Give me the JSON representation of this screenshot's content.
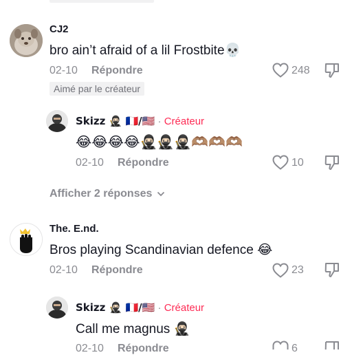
{
  "comments": [
    {
      "username": "CJ2",
      "text": "bro ain’t afraid of a lil Frostbite💀",
      "date": "02-10",
      "reply_label": "Répondre",
      "likes": "248",
      "badge": "Aimé par le créateur",
      "reply": {
        "username": "Skizz 🥷🏻 🇫🇷/🇺🇸",
        "separator": "·",
        "creator_label": "Créateur",
        "text": "😂😂😂😂🥷🏻🥷🏻🥷🏻🫶🏽🫶🏽🫶🏽",
        "date": "02-10",
        "reply_label": "Répondre",
        "likes": "10"
      },
      "view_replies": "Afficher 2 réponses"
    },
    {
      "username": "The. E.nd.",
      "text": "Bros playing Scandinavian defence 😂",
      "date": "02-10",
      "reply_label": "Répondre",
      "likes": "23",
      "reply": {
        "username": "Skizz 🥷🏻 🇫🇷/🇺🇸",
        "separator": "·",
        "creator_label": "Créateur",
        "text": "Call me magnus 🥷🏻",
        "date": "02-10",
        "reply_label": "Répondre",
        "likes": "6"
      }
    }
  ],
  "icons": {
    "heart": "heart-icon",
    "dislike": "thumbs-down-icon",
    "chevron": "chevron-down-icon"
  },
  "colors": {
    "creator": "#fe2c55",
    "muted": "#8a8b91",
    "badge_bg": "#f1f1f2"
  }
}
